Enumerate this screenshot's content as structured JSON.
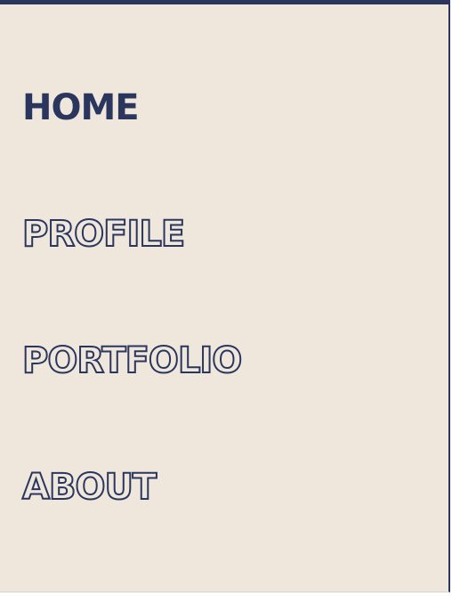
{
  "nav": {
    "items": [
      {
        "label": "HOME",
        "active": true
      },
      {
        "label": "PROFILE",
        "active": false
      },
      {
        "label": "PORTFOLIO",
        "active": false
      },
      {
        "label": "ABOUT",
        "active": false
      }
    ]
  },
  "colors": {
    "background": "#efe7dc",
    "accent": "#2a365e"
  }
}
